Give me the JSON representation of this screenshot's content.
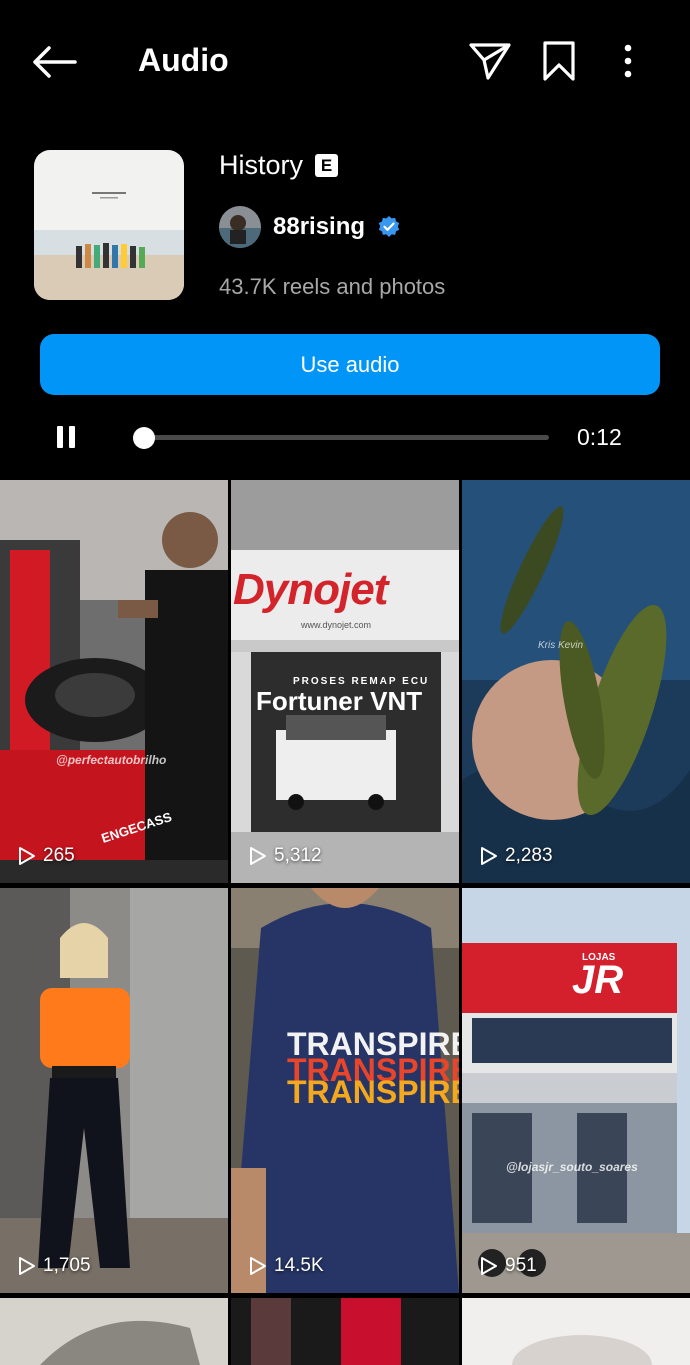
{
  "header": {
    "title": "Audio",
    "icons": [
      "back-arrow-icon",
      "send-icon",
      "bookmark-icon",
      "more-icon"
    ]
  },
  "audio": {
    "title": "History",
    "explicit_badge": "E",
    "artist": "88rising",
    "verified": true,
    "count": "43.7K reels and photos",
    "use_button": "Use audio",
    "elapsed": "0:12",
    "progress": 0.0
  },
  "reels": [
    {
      "views": "265",
      "watermark": "@perfectautobrilho",
      "brand": "ENGECASS"
    },
    {
      "views": "5,312",
      "sign": "Dynojet",
      "sign_url": "www.dynojet.com",
      "overlay_small": "PROSES REMAP ECU",
      "overlay_big": "Fortuner VNT"
    },
    {
      "views": "2,283",
      "watermark": "Kris Kevin"
    },
    {
      "views": "1,705"
    },
    {
      "views": "14.5K",
      "shirt": "TRANSPIRE"
    },
    {
      "views": "951",
      "store_small": "LOJAS",
      "store": "JR",
      "watermark": "@lojasjr_souto_soares"
    }
  ],
  "colors": {
    "accent": "#0095f6",
    "background": "#000000",
    "muted": "#a8a8a8",
    "verified": "#3897f0"
  }
}
